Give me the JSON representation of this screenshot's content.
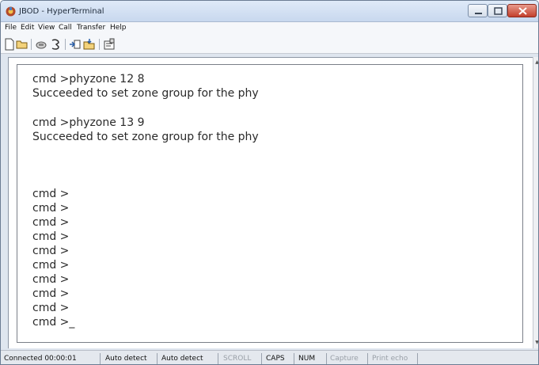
{
  "window": {
    "title": "JBOD - HyperTerminal"
  },
  "menu": [
    "File",
    "Edit",
    "View",
    "Call",
    "Transfer",
    "Help"
  ],
  "toolbar": {
    "icons": [
      "new-document-icon",
      "open-folder-icon",
      "phone-icon",
      "disconnect-icon",
      "send-icon",
      "receive-icon",
      "properties-icon"
    ]
  },
  "terminal": {
    "lines": [
      "cmd >phyzone 12 8",
      "Succeeded to set zone group for the phy",
      "cmd >phyzone 13 9",
      "Succeeded to set zone group for the phy",
      "cmd >",
      "cmd >",
      "cmd >",
      "cmd >",
      "cmd >",
      "cmd >",
      "cmd >",
      "cmd >",
      "cmd >",
      "cmd >_"
    ]
  },
  "status": {
    "connected": "Connected 00:00:01",
    "detect1": "Auto detect",
    "detect2": "Auto detect",
    "scroll": "SCROLL",
    "caps": "CAPS",
    "num": "NUM",
    "capture": "Capture",
    "print_echo": "Print echo"
  }
}
